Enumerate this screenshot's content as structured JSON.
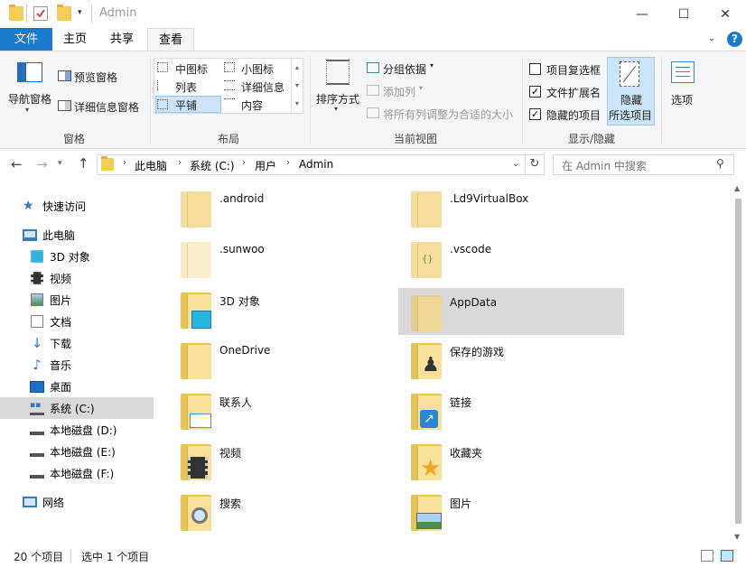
{
  "window": {
    "title": "Admin",
    "minimize_icon": "—",
    "maximize_icon": "☐",
    "close_icon": "✕"
  },
  "tabs": {
    "file": "文件",
    "home": "主页",
    "share": "共享",
    "view": "查看"
  },
  "ribbon": {
    "panes": {
      "nav_pane": "导航窗格",
      "preview_pane": "预览窗格",
      "details_pane": "详细信息窗格",
      "group": "窗格"
    },
    "layout": {
      "medium_icons": "中图标",
      "small_icons": "小图标",
      "list": "列表",
      "details": "详细信息",
      "tiles": "平铺",
      "content": "内容",
      "group": "布局"
    },
    "current_view": {
      "sort_by": "排序方式",
      "group_by": "分组依据",
      "add_columns": "添加列",
      "size_all_columns": "将所有列调整为合适的大小",
      "group": "当前视图"
    },
    "show_hide": {
      "item_checkboxes": "项目复选框",
      "file_extensions": "文件扩展名",
      "hidden_items": "隐藏的项目",
      "hide_selected_1": "隐藏",
      "hide_selected_2": "所选项目",
      "group": "显示/隐藏"
    },
    "options": "选项"
  },
  "address": {
    "path": [
      "此电脑",
      "系统 (C:)",
      "用户",
      "Admin"
    ],
    "search_placeholder": "在 Admin 中搜索"
  },
  "nav": [
    {
      "label": "快速访问",
      "icon": "quick-access-star-icon"
    },
    {
      "label": "此电脑",
      "icon": "this-pc-icon"
    },
    {
      "label": "3D 对象",
      "icon": "3d-objects-icon"
    },
    {
      "label": "视频",
      "icon": "videos-icon"
    },
    {
      "label": "图片",
      "icon": "pictures-icon"
    },
    {
      "label": "文档",
      "icon": "documents-icon"
    },
    {
      "label": "下载",
      "icon": "downloads-icon"
    },
    {
      "label": "音乐",
      "icon": "music-icon"
    },
    {
      "label": "桌面",
      "icon": "desktop-icon"
    },
    {
      "label": "系统 (C:)",
      "icon": "system-drive-icon"
    },
    {
      "label": "本地磁盘 (D:)",
      "icon": "drive-icon"
    },
    {
      "label": "本地磁盘 (E:)",
      "icon": "drive-icon"
    },
    {
      "label": "本地磁盘 (F:)",
      "icon": "drive-icon"
    },
    {
      "label": "网络",
      "icon": "network-icon"
    }
  ],
  "items": [
    {
      "label": ".android"
    },
    {
      "label": ".Ld9VirtualBox"
    },
    {
      "label": ".sunwoo"
    },
    {
      "label": ".vscode"
    },
    {
      "label": "3D 对象"
    },
    {
      "label": "AppData"
    },
    {
      "label": "OneDrive"
    },
    {
      "label": "保存的游戏"
    },
    {
      "label": "联系人"
    },
    {
      "label": "链接"
    },
    {
      "label": "视频"
    },
    {
      "label": "收藏夹"
    },
    {
      "label": "搜索"
    },
    {
      "label": "图片"
    }
  ],
  "status": {
    "count": "20 个项目",
    "selected": "选中 1 个项目"
  },
  "colors": {
    "accent": "#1979ca",
    "selection": "#d9d9d9",
    "folder": "#f3cd55"
  }
}
